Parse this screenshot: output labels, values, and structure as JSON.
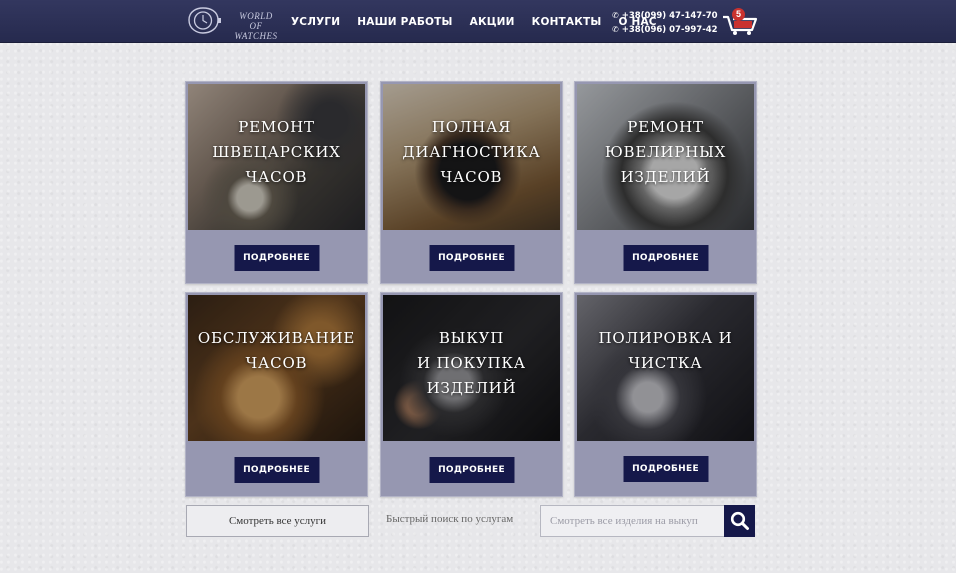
{
  "header": {
    "logo_text_line1": "WORLD OF",
    "logo_text_line2": "WATCHES",
    "nav": [
      {
        "label": "УСЛУГИ"
      },
      {
        "label": "НАШИ РАБОТЫ"
      },
      {
        "label": "АКЦИИ"
      },
      {
        "label": "КОНТАКТЫ"
      },
      {
        "label": "О НАС"
      }
    ],
    "phones": [
      "+38(099) 47-147-70",
      "+38(096) 07-997-42"
    ],
    "phone_icon": "phone-icon",
    "cart_count": "5",
    "cart_icon": "shopping-cart-icon"
  },
  "colors": {
    "header_bg": "#2c3056",
    "button_bg": "#15184a",
    "card_bg": "#9697b1",
    "cart_badge": "#c9322f"
  },
  "cards": [
    {
      "title": "РЕМОНТ\nШВЕЦАРСКИХ\nЧАСОВ",
      "button": "ПОДРОБНЕЕ"
    },
    {
      "title": "ПОЛНАЯ\nДИАГНОСТИКА\nЧАСОВ",
      "button": "ПОДРОБНЕЕ"
    },
    {
      "title": "РЕМОНТ\nЮВЕЛИРНЫХ\nИЗДЕЛИЙ",
      "button": "ПОДРОБНЕЕ"
    },
    {
      "title": "ОБСЛУЖИВАНИЕ\nЧАСОВ",
      "button": "ПОДРОБНЕЕ"
    },
    {
      "title": "ВЫКУП\nИ ПОКУПКА\nИЗДЕЛИЙ",
      "button": "ПОДРОБНЕЕ"
    },
    {
      "title": "ПОЛИРОВКА И\nЧИСТКА",
      "button": "ПОДРОБНЕЕ"
    }
  ],
  "bottom": {
    "all_services": "Смотреть все услуги",
    "quick_search_label": "Быстрый поиск по услугам",
    "search_placeholder": "Смотреть все изделия на выкуп",
    "search_icon": "search-icon"
  }
}
